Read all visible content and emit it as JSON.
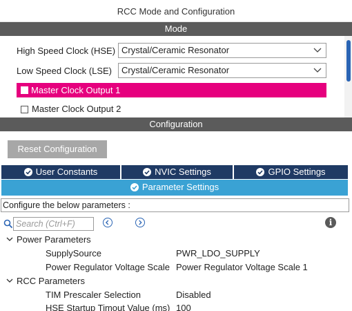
{
  "title": "RCC Mode and Configuration",
  "mode": {
    "header": "Mode",
    "hse": {
      "label": "High Speed Clock (HSE)",
      "value": "Crystal/Ceramic Resonator"
    },
    "lse": {
      "label": "Low Speed Clock (LSE)",
      "value": "Crystal/Ceramic Resonator"
    },
    "mco1": {
      "label": "Master Clock Output 1",
      "checked": false
    },
    "mco2": {
      "label": "Master Clock Output 2",
      "checked": false
    }
  },
  "configuration": {
    "header": "Configuration",
    "reset_label": "Reset Configuration",
    "tabs": [
      {
        "label": "User Constants"
      },
      {
        "label": "NVIC Settings"
      },
      {
        "label": "GPIO Settings"
      }
    ],
    "active_tab": {
      "label": "Parameter Settings"
    },
    "description": "Configure the below parameters :",
    "search_placeholder": "Search (Ctrl+F)",
    "groups": [
      {
        "name": "Power Parameters",
        "params": [
          {
            "name": "SupplySource",
            "value": "PWR_LDO_SUPPLY"
          },
          {
            "name": "Power Regulator Voltage Scale",
            "value": "Power Regulator Voltage Scale 1"
          }
        ]
      },
      {
        "name": "RCC Parameters",
        "params": [
          {
            "name": "TIM Prescaler Selection",
            "value": "Disabled"
          },
          {
            "name": "HSE Startup Timout Value (ms)",
            "value": "100"
          }
        ]
      }
    ]
  },
  "colors": {
    "section_header": "#5b5b5b",
    "highlight": "#e6007e",
    "tab_dark": "#1f3a64",
    "tab_active": "#3aa2d4",
    "accent": "#2a64b4"
  }
}
